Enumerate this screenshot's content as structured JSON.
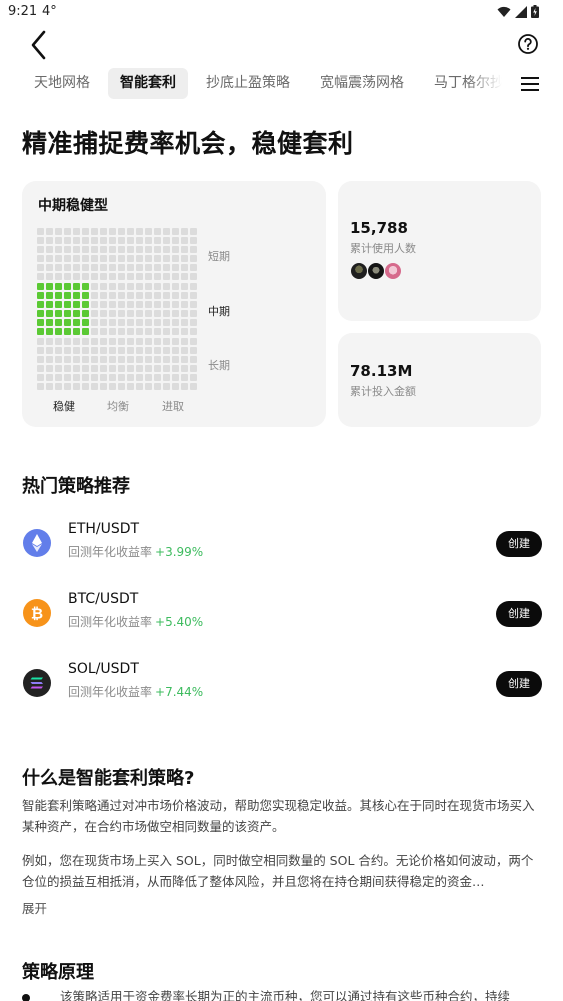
{
  "status_bar": {
    "time": "9:21",
    "temperature": "4°"
  },
  "tabs": [
    {
      "label": "天地网格",
      "active": false
    },
    {
      "label": "智能套利",
      "active": true
    },
    {
      "label": "抄底止盈策略",
      "active": false
    },
    {
      "label": "宽幅震荡网格",
      "active": false
    },
    {
      "label": "马丁格尔抄底",
      "active": false
    }
  ],
  "hero": {
    "title": "精准捕捉费率机会，稳健套利"
  },
  "risk_card": {
    "title": "中期稳健型",
    "row_labels": [
      "短期",
      "中期",
      "长期"
    ],
    "col_labels": [
      "稳健",
      "均衡",
      "进取"
    ],
    "selected": {
      "row": "中期",
      "col": "稳健"
    },
    "active_color": "#5bc934"
  },
  "stats": {
    "users": {
      "value": "15,788",
      "label": "累计使用人数"
    },
    "invested": {
      "value": "78.13M",
      "label": "累计投入金额"
    }
  },
  "popular": {
    "title": "热门策略推荐",
    "items": [
      {
        "pair": "ETH/USDT",
        "yield_label": "回测年化收益率",
        "yield": "+3.99%",
        "button": "创建",
        "icon": "ethereum-icon",
        "color": "#627eea"
      },
      {
        "pair": "BTC/USDT",
        "yield_label": "回测年化收益率",
        "yield": "+5.40%",
        "button": "创建",
        "icon": "bitcoin-icon",
        "color": "#f7931a"
      },
      {
        "pair": "SOL/USDT",
        "yield_label": "回测年化收益率",
        "yield": "+7.44%",
        "button": "创建",
        "icon": "solana-icon",
        "color": "#222222"
      }
    ]
  },
  "about": {
    "title": "什么是智能套利策略?",
    "paragraph1": "智能套利策略通过对冲市场价格波动，帮助您实现稳定收益。其核心在于同时在现货市场买入某种资产，在合约市场做空相同数量的该资产。",
    "paragraph2": "例如，您在现货市场上买入 SOL，同时做空相同数量的 SOL 合约。无论价格如何波动，两个仓位的损益互相抵消，从而降低了整体风险，并且您将在持仓期间获得稳定的资金…",
    "expand": "展开"
  },
  "principle": {
    "title": "策略原理",
    "bullet": "该策略适用于资金费率长期为正的主流币种，您可以通过持有这些币种合约，持续"
  }
}
